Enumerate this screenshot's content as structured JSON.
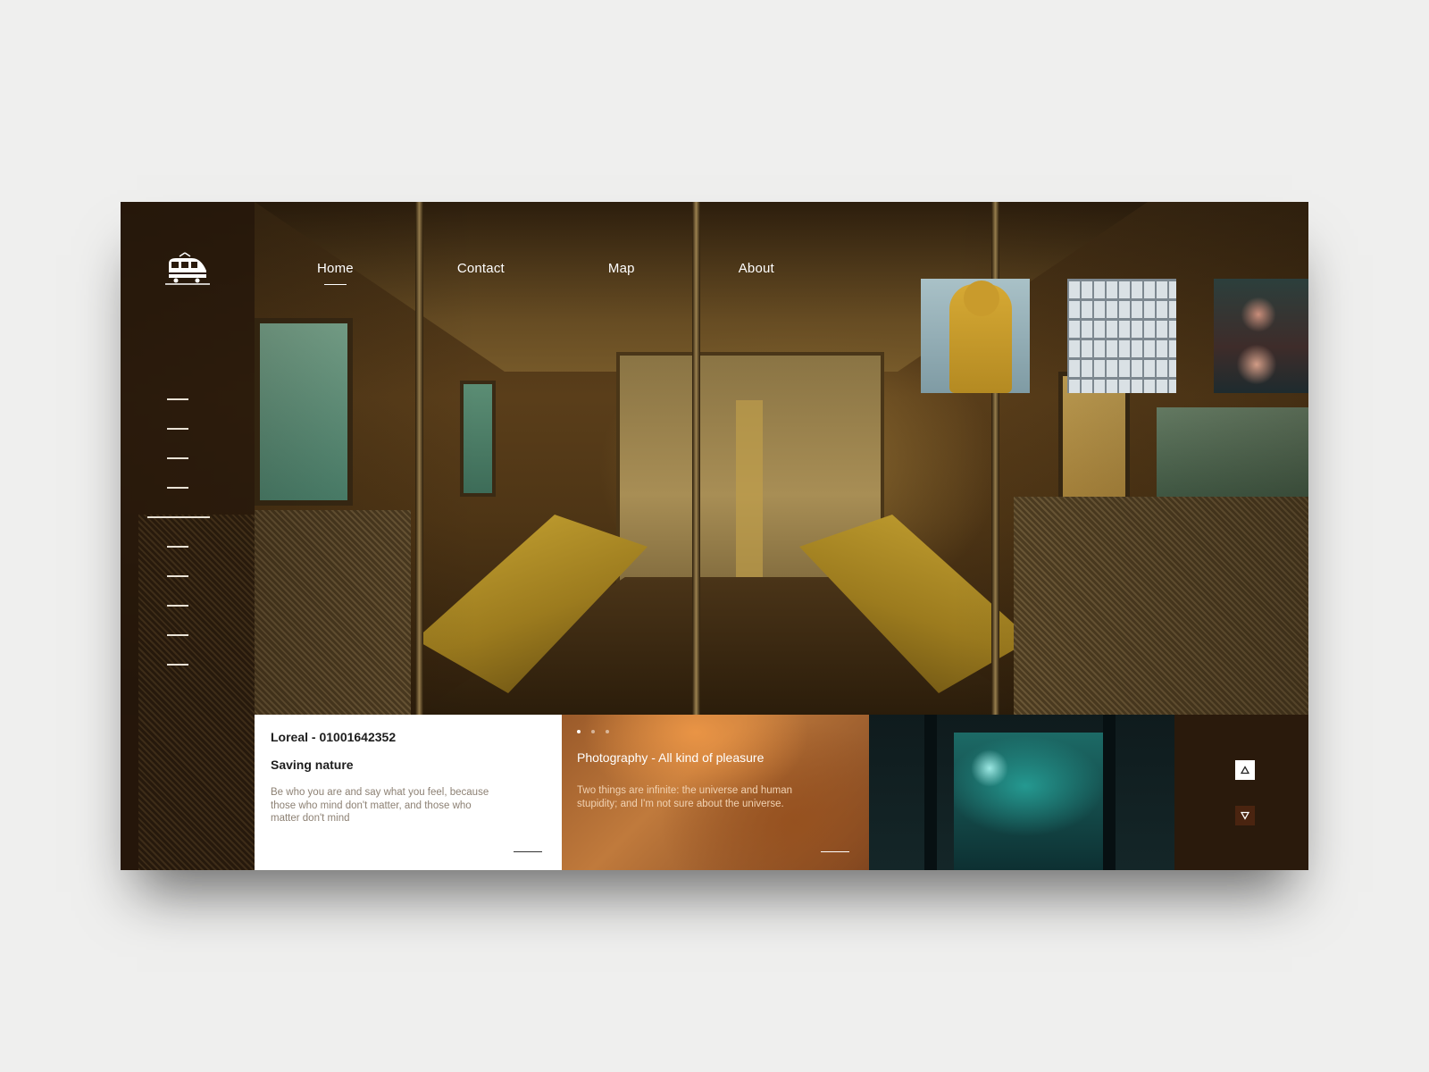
{
  "nav": {
    "items": [
      {
        "label": "Home",
        "active": true
      },
      {
        "label": "Contact",
        "active": false
      },
      {
        "label": "Map",
        "active": false
      },
      {
        "label": "About",
        "active": false
      }
    ]
  },
  "logo": {
    "icon": "train-icon"
  },
  "cards": {
    "first": {
      "title": "Loreal - 01001642352",
      "subtitle": "Saving nature",
      "body": "Be who you are and say what you feel, because those who mind don't matter, and those who matter don't mind"
    },
    "second": {
      "title": "Photography - All kind of pleasure",
      "body": "Two things are infinite: the universe and human stupidity; and I'm not sure about the universe."
    }
  },
  "colors": {
    "card_white": "#ffffff",
    "card_orange": "#c07a3c",
    "arrow_down_bg": "#4a2410",
    "text_muted": "#8d8174"
  },
  "icons": {
    "arrow_up": "triangle-up-icon",
    "arrow_down": "triangle-down-icon"
  }
}
